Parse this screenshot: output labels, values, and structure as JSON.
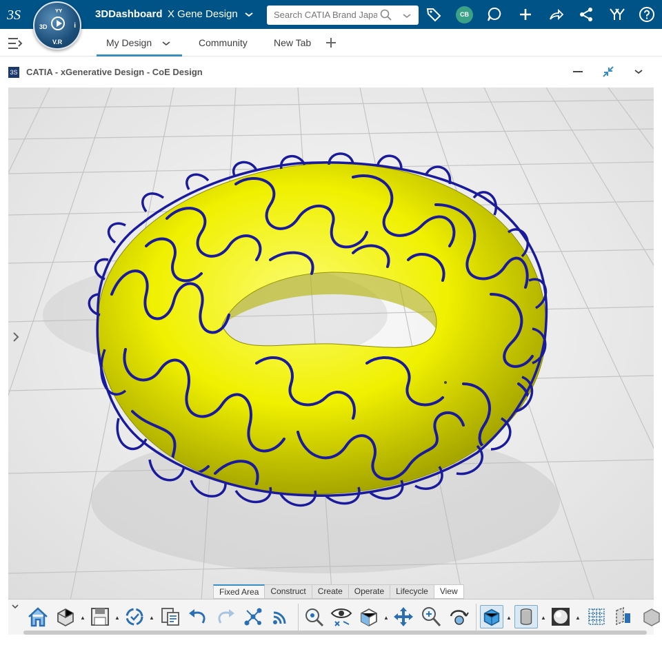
{
  "topbar": {
    "app_title": "3DDashboard",
    "dashboard_name": "X Gene Design",
    "search_placeholder": "Search CATIA Brand Japa",
    "avatar_initials": "CB",
    "compass": {
      "label_3d": "3D",
      "label_i": "i",
      "label_v": "V.R"
    }
  },
  "tabs": [
    {
      "label": "My Design"
    },
    {
      "label": "Community"
    },
    {
      "label": "New Tab"
    }
  ],
  "widget": {
    "title": "CATIA - xGenerative Design - CoE Design"
  },
  "action_bar": {
    "tabs": [
      "Fixed Area",
      "Construct",
      "Create",
      "Operate",
      "Lifecycle",
      "View"
    ],
    "selected_tab": "View"
  },
  "colors": {
    "topbar": "#005386",
    "torus": "#f0f000",
    "wire": "#1a1a9c",
    "accent": "#368ec4"
  }
}
